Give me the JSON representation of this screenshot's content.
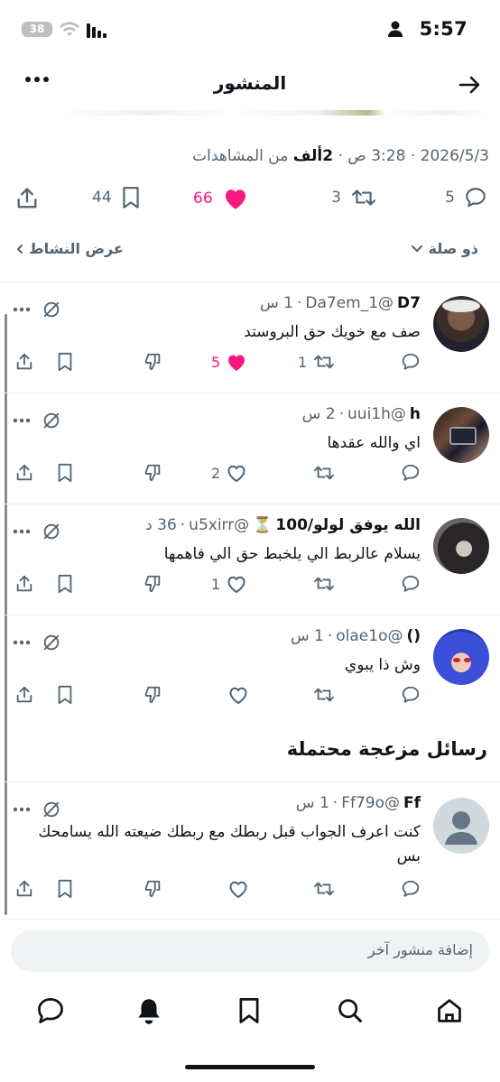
{
  "status_bar": {
    "time": "5:57",
    "battery": "38"
  },
  "header": {
    "title": "المنشور"
  },
  "post_meta": {
    "date": "2026/5/3",
    "time": "3:28 ص",
    "views_count": "2ألف",
    "views_label": "من المشاهدات",
    "sep": "·"
  },
  "post_actions": {
    "replies": "5",
    "reposts": "3",
    "likes": "66",
    "bookmarks": "44"
  },
  "sort": {
    "label": "ذو صلة",
    "activity": "عرض النشاط"
  },
  "replies": [
    {
      "name": "D7",
      "handle": "@Da7em_1",
      "time": "1 س",
      "sep": "·",
      "text": "صف مع خويك حق البروستد",
      "replies": "",
      "reposts": "1",
      "likes": "5",
      "liked": true
    },
    {
      "name": "h",
      "handle": "@uui1h",
      "time": "2 س",
      "sep": "·",
      "text": "اي والله عقدها",
      "replies": "",
      "reposts": "",
      "likes": "2",
      "liked": false
    },
    {
      "name": "الله يوفق لولو/100",
      "emoji": "⏳",
      "handle": "@u5xirr",
      "time": "36 د",
      "sep": "·",
      "text": "يسلام عالربط الي يلخبط حق الي فاهمها",
      "replies": "",
      "reposts": "",
      "likes": "1",
      "liked": false
    },
    {
      "name": "()",
      "handle": "@olae1o",
      "time": "1 س",
      "sep": "·",
      "text": "وش ذا يبوي",
      "replies": "",
      "reposts": "",
      "likes": "",
      "liked": false
    }
  ],
  "spam_section": {
    "title": "رسائل مزعجة محتملة"
  },
  "spam_reply": {
    "name": "Ff",
    "handle": "@Ff79o",
    "time": "1 س",
    "sep": "·",
    "text": "كنت اعرف الجواب قبل ربطك مع ربطك ضيعته الله يسامحك بس",
    "likes": ""
  },
  "composer": {
    "placeholder": "إضافة منشور آخر"
  },
  "colors": {
    "like": "#f91880",
    "muted": "#536471",
    "text": "#0f1419"
  }
}
